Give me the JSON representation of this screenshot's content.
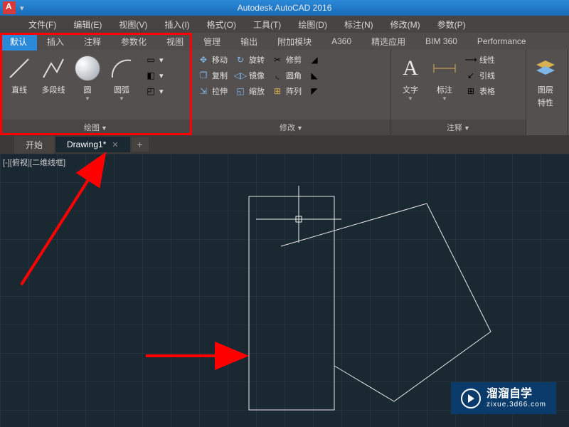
{
  "app": {
    "title": "Autodesk AutoCAD 2016"
  },
  "menu": {
    "items": [
      "文件(F)",
      "编辑(E)",
      "视图(V)",
      "插入(I)",
      "格式(O)",
      "工具(T)",
      "绘图(D)",
      "标注(N)",
      "修改(M)",
      "参数(P)"
    ]
  },
  "ribbon_tabs": {
    "items": [
      "默认",
      "插入",
      "注释",
      "参数化",
      "视图",
      "管理",
      "输出",
      "附加模块",
      "A360",
      "精选应用",
      "BIM 360",
      "Performance"
    ],
    "active": 0
  },
  "ribbon": {
    "draw": {
      "title": "绘图",
      "line": "直线",
      "polyline": "多段线",
      "circle": "圆",
      "arc": "圆弧"
    },
    "modify": {
      "title": "修改",
      "move": "移动",
      "rotate": "旋转",
      "trim": "修剪",
      "copy": "复制",
      "mirror": "镜像",
      "fillet": "圆角",
      "stretch": "拉伸",
      "scale": "缩放",
      "array": "阵列"
    },
    "annotate": {
      "title": "注释",
      "text": "文字",
      "dim": "标注",
      "linetype": "线性",
      "leader": "引线",
      "table": "表格"
    },
    "layers": {
      "title": "图层",
      "props": "特性"
    }
  },
  "doc_tabs": {
    "start": "开始",
    "drawing": "Drawing1*"
  },
  "viewport": {
    "label": "[-][俯视][二维线框]"
  },
  "watermark": {
    "text": "溜溜自学",
    "url": "zixue.3d66.com"
  }
}
